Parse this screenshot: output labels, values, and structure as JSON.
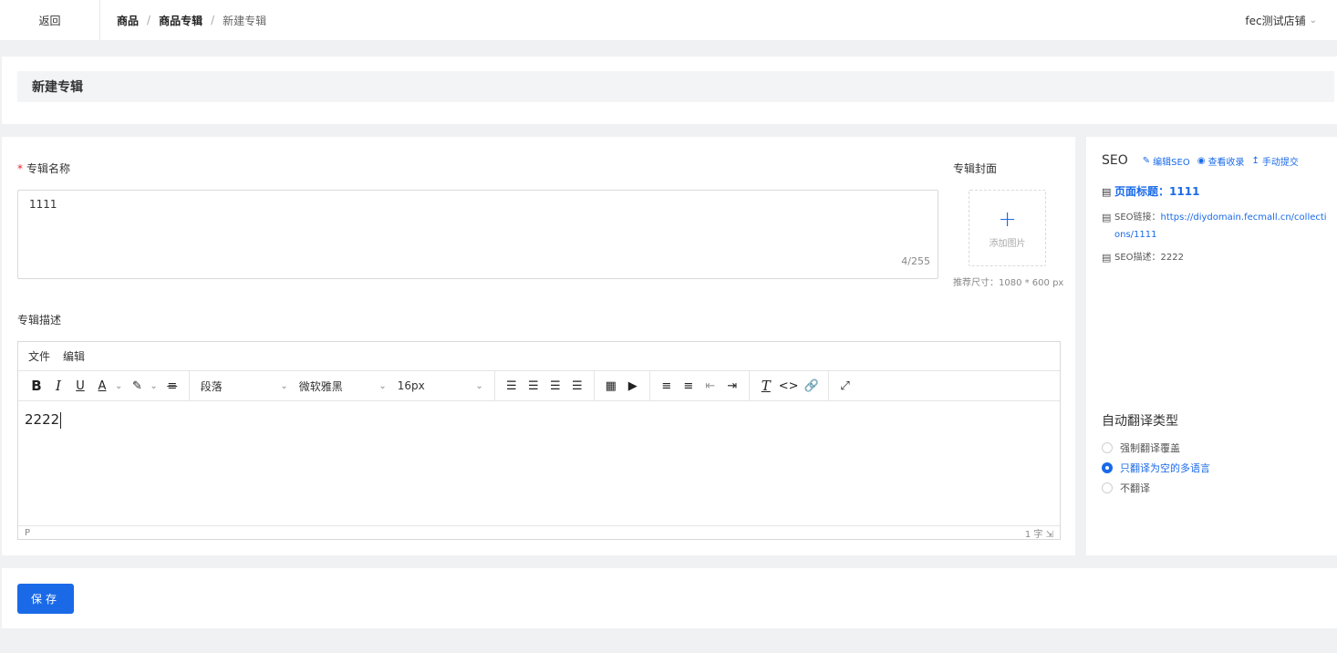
{
  "topbar": {
    "back_label": "返回",
    "breadcrumb": [
      "商品",
      "商品专辑",
      "新建专辑"
    ],
    "separator": "/",
    "store_name": "fec测试店铺"
  },
  "page": {
    "title": "新建专辑"
  },
  "form": {
    "name_label": "专辑名称",
    "name_required_mark": "*",
    "name_value": "1111",
    "name_count": "4/255",
    "cover_label": "专辑封面",
    "cover_add_text": "添加图片",
    "cover_hint": "推荐尺寸：1080 * 600 px",
    "desc_label": "专辑描述"
  },
  "editor": {
    "menu": [
      "文件",
      "编辑"
    ],
    "block_format": "段落",
    "font_family": "微软雅黑",
    "font_size": "16px",
    "content": "2222",
    "status_path": "P",
    "word_count": "1 字"
  },
  "seo": {
    "title": "SEO",
    "edit_label": "编辑SEO",
    "view_label": "查看收录",
    "submit_label": "手动提交",
    "page_title_label": "页面标题：",
    "page_title_value": "1111",
    "link_label": "SEO链接：",
    "link_value": "https://diydomain.fecmall.cn/collections/1111",
    "desc_label": "SEO描述：",
    "desc_value": "2222"
  },
  "translate": {
    "label": "自动翻译类型",
    "options": [
      "强制翻译覆盖",
      "只翻译为空的多语言",
      "不翻译"
    ],
    "selected_index": 1
  },
  "actions": {
    "save_label": "保存"
  },
  "colors": {
    "primary": "#1a6ae8",
    "required": "#f5222d",
    "background": "#f0f1f3"
  }
}
